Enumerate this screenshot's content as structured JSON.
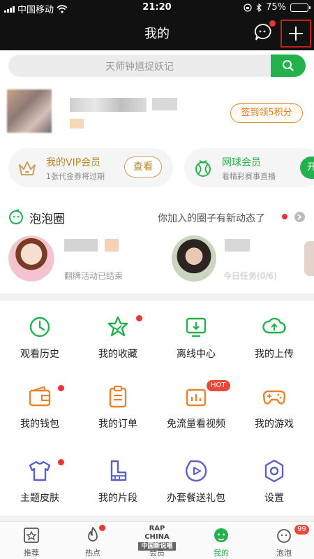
{
  "status_bar": {
    "carrier": "中国移动",
    "time": "21:20",
    "battery": "75%",
    "battery_level": 0.75
  },
  "header": {
    "title": "我的"
  },
  "search": {
    "placeholder": "天师钟馗捉妖记"
  },
  "profile": {
    "checkin_label": "签到领5积分"
  },
  "vip_card": {
    "title": "我的VIP会员",
    "subtitle": "1张代金券将过期",
    "button": "查看"
  },
  "tennis_card": {
    "title": "网球会员",
    "subtitle": "看精彩赛事直播",
    "button": "开"
  },
  "bubble": {
    "title": "泡泡圈",
    "note": "你加入的圈子有新动态了",
    "fan1_text": "翻牌活动已结束",
    "fan2_text": "今日任务(0/6)"
  },
  "grid": [
    {
      "label": "观看历史",
      "icon": "clock-icon",
      "dot": false
    },
    {
      "label": "我的收藏",
      "icon": "star-icon",
      "dot": true
    },
    {
      "label": "离线中心",
      "icon": "download-icon",
      "dot": false
    },
    {
      "label": "我的上传",
      "icon": "upload-icon",
      "dot": false
    },
    {
      "label": "我的钱包",
      "icon": "wallet-icon",
      "dot": true
    },
    {
      "label": "我的订单",
      "icon": "order-icon",
      "dot": false
    },
    {
      "label": "免流量看视频",
      "icon": "tv-icon",
      "dot": false,
      "badge": "HOT"
    },
    {
      "label": "我的游戏",
      "icon": "gamepad-icon",
      "dot": false
    },
    {
      "label": "主题皮肤",
      "icon": "tshirt-icon",
      "dot": true
    },
    {
      "label": "我的片段",
      "icon": "clip-icon",
      "dot": false
    },
    {
      "label": "办套餐送礼包",
      "icon": "play-circle-icon",
      "dot": false
    },
    {
      "label": "设置",
      "icon": "gear-icon",
      "dot": false
    }
  ],
  "tabbar": {
    "tabs": [
      {
        "label": "推荐"
      },
      {
        "label": "热点"
      },
      {
        "label": "会员",
        "logo_top": "RAP CHINA",
        "logo_bottom": "中国新说唱"
      },
      {
        "label": "我的"
      },
      {
        "label": "泡泡",
        "badge": "99"
      }
    ]
  },
  "colors": {
    "accent": "#22b14c",
    "header_bg": "#111111",
    "checkin": "#e07a1c",
    "vip_gold": "#b8862a",
    "alert_red": "#e33333"
  }
}
